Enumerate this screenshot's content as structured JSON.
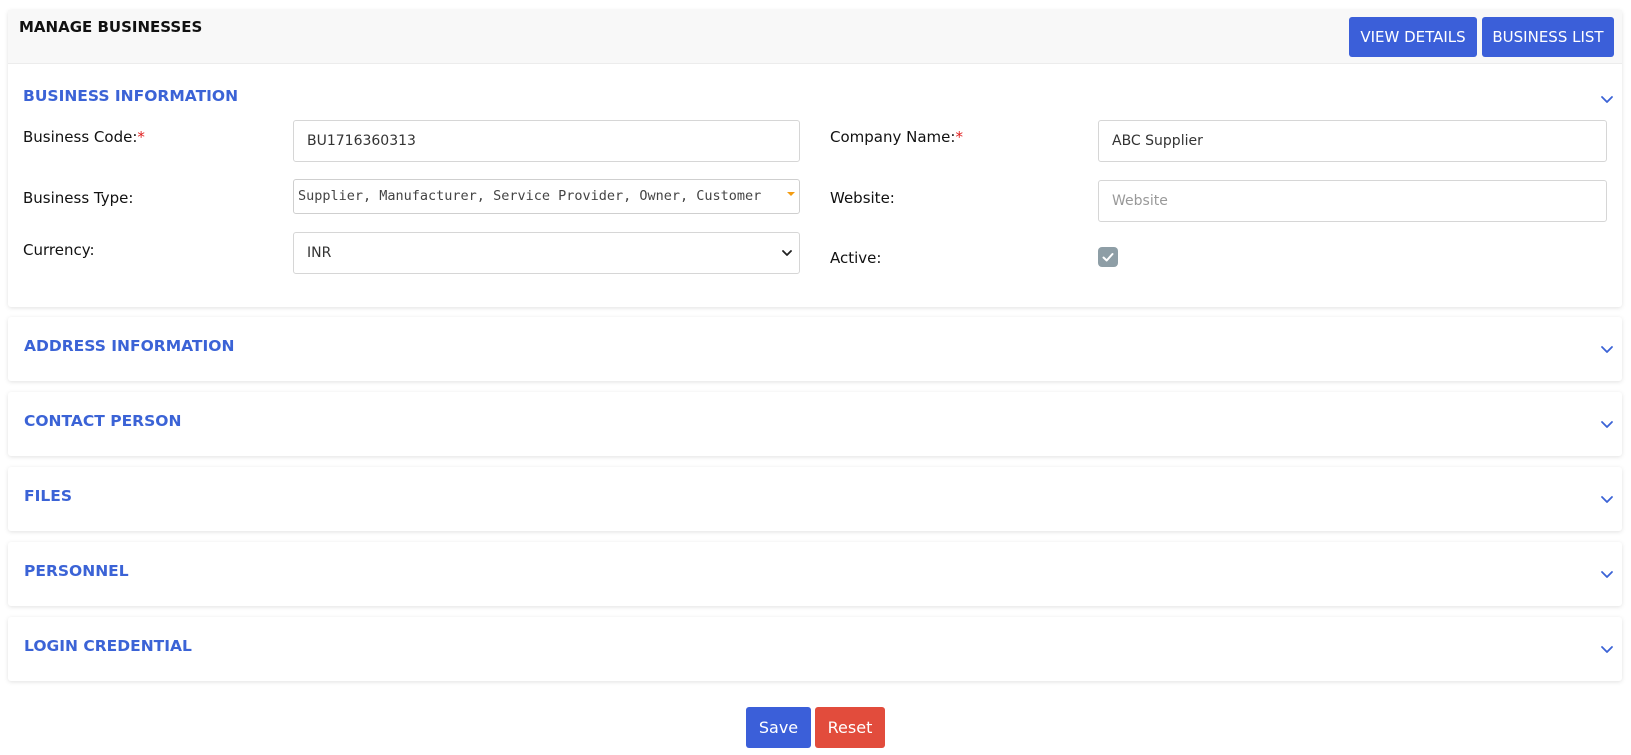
{
  "header": {
    "title": "MANAGE BUSINESSES",
    "view_details_label": "VIEW DETAILS",
    "business_list_label": "BUSINESS LIST"
  },
  "business_info": {
    "title": "BUSINESS INFORMATION",
    "business_code_label": "Business Code:",
    "business_code_value": "BU1716360313",
    "company_name_label": "Company Name:",
    "company_name_value": "ABC Supplier",
    "business_type_label": "Business Type:",
    "business_type_value": "Supplier, Manufacturer, Service Provider, Owner, Customer",
    "website_label": "Website:",
    "website_placeholder": "Website",
    "currency_label": "Currency:",
    "currency_value": "INR",
    "active_label": "Active:",
    "active_checked": true,
    "required_mark": "*"
  },
  "sections": [
    {
      "title": "ADDRESS INFORMATION"
    },
    {
      "title": "CONTACT PERSON"
    },
    {
      "title": "FILES"
    },
    {
      "title": "PERSONNEL"
    },
    {
      "title": "LOGIN CREDENTIAL"
    }
  ],
  "footer": {
    "save_label": "Save",
    "reset_label": "Reset"
  },
  "colors": {
    "primary": "#3b5fd9",
    "section_title": "#3b63d6",
    "danger": "#e24c3c",
    "required": "#e02020",
    "checkbox": "#8e9ea6",
    "dropdown_caret": "#f39c12"
  },
  "icons": {
    "section_toggle": "chevron-down-icon",
    "checkbox_mark": "check-icon",
    "select_arrow": "chevron-down-icon",
    "multiselect_caret": "caret-down-icon"
  }
}
